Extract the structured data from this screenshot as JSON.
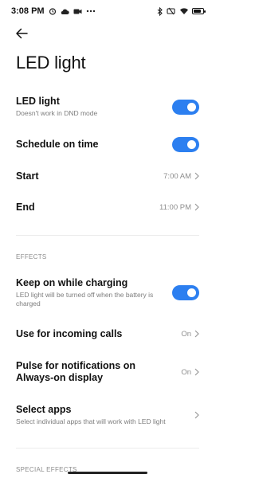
{
  "status_bar": {
    "time": "3:08 PM",
    "left_icons": [
      "alarm-icon",
      "cloud-icon",
      "video-icon",
      "more-dots-icon"
    ],
    "right_icons": [
      "bluetooth-icon",
      "battery-saver-icon",
      "wifi-icon",
      "battery-icon"
    ]
  },
  "header": {
    "back_icon": "arrow-left-icon",
    "title": "LED light"
  },
  "settings": {
    "led_light": {
      "title": "LED light",
      "subtitle": "Doesn't work in DND mode",
      "enabled": true
    },
    "schedule": {
      "title": "Schedule on time",
      "enabled": true
    },
    "start": {
      "title": "Start",
      "value": "7:00 AM"
    },
    "end": {
      "title": "End",
      "value": "11:00 PM"
    }
  },
  "effects": {
    "header": "EFFECTS",
    "keep_on": {
      "title": "Keep on while charging",
      "subtitle": "LED light will be turned off when the battery is charged",
      "enabled": true
    },
    "incoming_calls": {
      "title": "Use for incoming calls",
      "value": "On"
    },
    "pulse": {
      "title_line1": "Pulse for notifications on",
      "title_line2": "Always-on display",
      "value": "On"
    },
    "select_apps": {
      "title": "Select apps",
      "subtitle": "Select individual apps that will work with LED light"
    }
  },
  "special_effects": {
    "header": "SPECIAL EFFECTS"
  },
  "colors": {
    "accent": "#2c7ff0",
    "text": "#111111",
    "secondary": "#7d7d7d"
  }
}
